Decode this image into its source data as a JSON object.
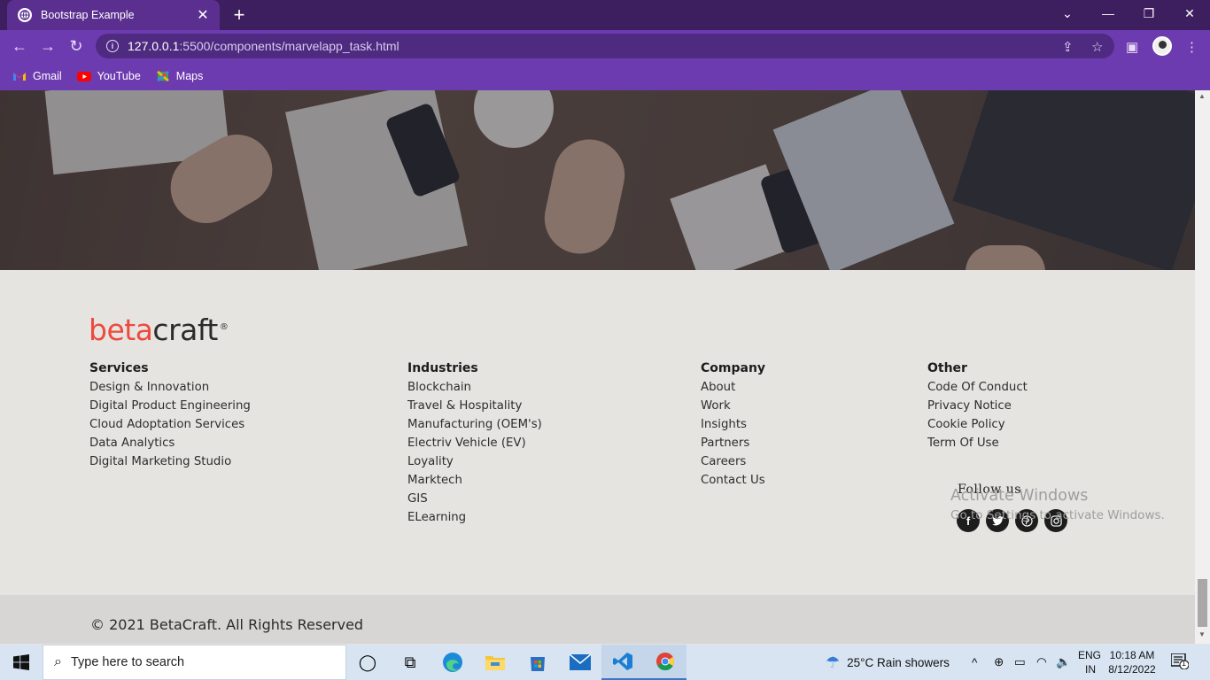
{
  "browser": {
    "tab_title": "Bootstrap Example",
    "url_host": "127.0.0.1",
    "url_path": ":5500/components/marvelapp_task.html",
    "bookmarks": [
      {
        "label": "Gmail",
        "icon": "gmail-icon"
      },
      {
        "label": "YouTube",
        "icon": "youtube-icon"
      },
      {
        "label": "Maps",
        "icon": "maps-icon"
      }
    ],
    "accent": "#6d3bb0"
  },
  "footer": {
    "logo": {
      "beta": "beta",
      "craft": "craft",
      "reg": "®"
    },
    "columns": [
      {
        "heading": "Services",
        "items": [
          "Design & Innovation",
          "Digital Product Engineering",
          "Cloud Adoptation Services",
          "Data Analytics",
          "Digital Marketing Studio"
        ]
      },
      {
        "heading": "Industries",
        "items": [
          "Blockchain",
          "Travel & Hospitality",
          "Manufacturing (OEM's)",
          "Electriv Vehicle (EV)",
          "Loyality",
          "Marktech",
          "GIS",
          "ELearning"
        ]
      },
      {
        "heading": "Company",
        "items": [
          "About",
          "Work",
          "Insights",
          "Partners",
          "Careers",
          "Contact Us"
        ]
      },
      {
        "heading": "Other",
        "items": [
          "Code Of Conduct",
          "Privacy Notice",
          "Cookie Policy",
          "Term Of Use"
        ]
      }
    ],
    "follow_label": "Follow us",
    "socials": [
      "facebook-icon",
      "twitter-icon",
      "pinterest-icon",
      "instagram-icon"
    ],
    "copyright": "© 2021 BetaCraft. All Rights Reserved",
    "logo_color": "#ee4a3d"
  },
  "watermark": {
    "line1": "Activate Windows",
    "line2": "Go to Settings to activate Windows."
  },
  "taskbar": {
    "search_placeholder": "Type here to search",
    "weather": "25°C  Rain showers",
    "lang_top": "ENG",
    "lang_bottom": "IN",
    "time": "10:18 AM",
    "date": "8/12/2022",
    "notification_count": "1"
  }
}
